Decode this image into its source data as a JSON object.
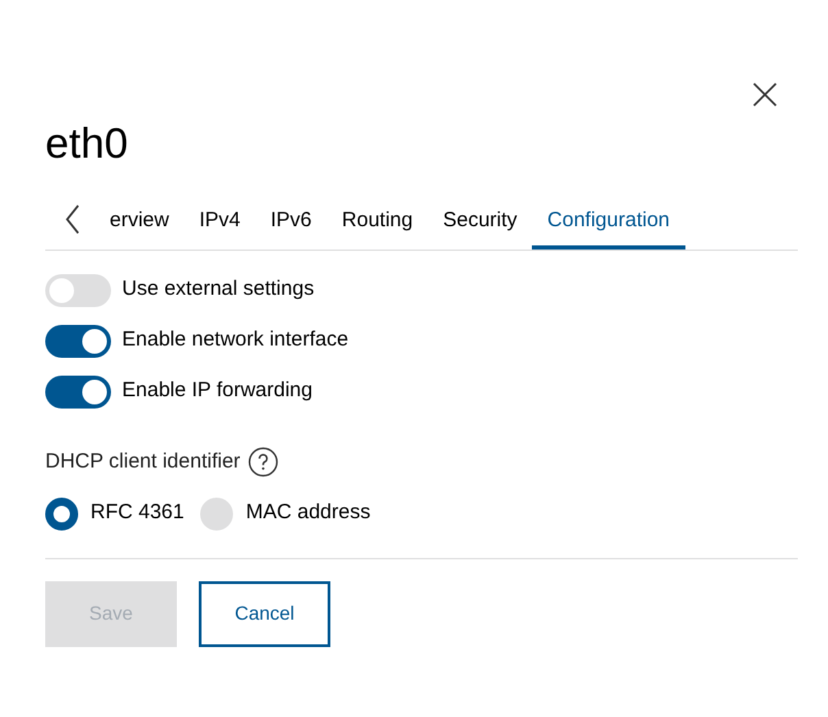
{
  "dialog": {
    "title": "eth0"
  },
  "tabs": [
    {
      "label": "erview",
      "selected": false
    },
    {
      "label": "IPv4",
      "selected": false
    },
    {
      "label": "IPv6",
      "selected": false
    },
    {
      "label": "Routing",
      "selected": false
    },
    {
      "label": "Security",
      "selected": false
    },
    {
      "label": "Configuration",
      "selected": true
    }
  ],
  "toggles": [
    {
      "label": "Use external settings",
      "on": false
    },
    {
      "label": "Enable network interface",
      "on": true
    },
    {
      "label": "Enable IP forwarding",
      "on": true
    }
  ],
  "dhcp": {
    "label": "DHCP client identifier",
    "options": [
      {
        "label": "RFC 4361",
        "selected": true
      },
      {
        "label": "MAC address",
        "selected": false
      }
    ]
  },
  "buttons": [
    {
      "label": "Save",
      "kind": "primary",
      "disabled": true
    },
    {
      "label": "Cancel",
      "kind": "secondary",
      "disabled": false
    }
  ]
}
